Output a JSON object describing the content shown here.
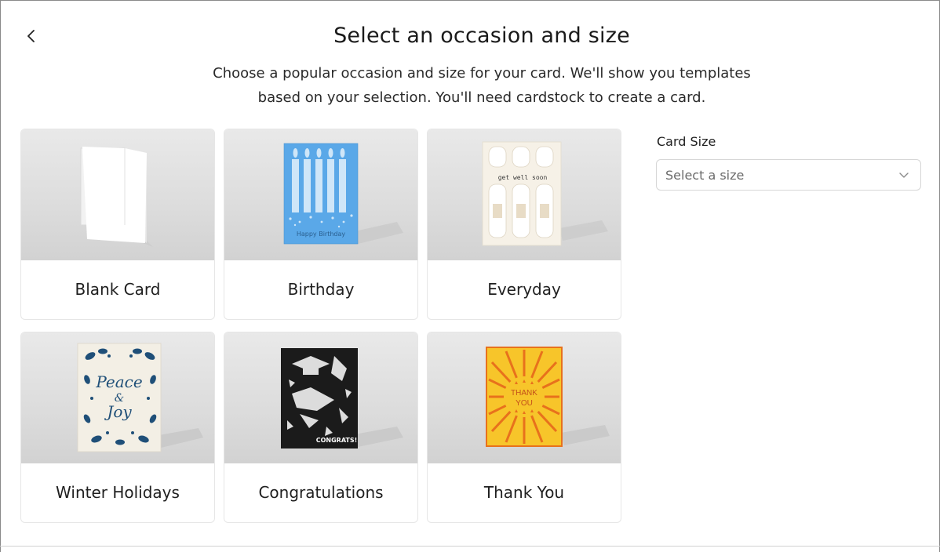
{
  "header": {
    "back_icon": "chevron-left-icon",
    "title": "Select an occasion and size",
    "subtitle_line1": "Choose a popular occasion and size for your card. We'll show you templates",
    "subtitle_line2": "based on your selection. You'll need cardstock to create a card."
  },
  "occasions": [
    {
      "label": "Blank Card"
    },
    {
      "label": "Birthday"
    },
    {
      "label": "Everyday"
    },
    {
      "label": "Winter Holidays"
    },
    {
      "label": "Congratulations"
    },
    {
      "label": "Thank You"
    }
  ],
  "card_art_text": {
    "birthday": "Happy Birthday",
    "everyday": "get well soon",
    "winter_1": "Peace",
    "winter_amp": "&",
    "winter_2": "Joy",
    "congrats": "CONGRATS!",
    "thank_1": "THANK",
    "thank_2": "YOU"
  },
  "card_size": {
    "label": "Card Size",
    "placeholder": "Select a size",
    "chevron_icon": "chevron-down-icon"
  },
  "colors": {
    "birthday_blue": "#5aa8e8",
    "winter_navy": "#1f4f78",
    "thank_orange": "#f0a41c",
    "congrats_black": "#1b1b1b"
  }
}
